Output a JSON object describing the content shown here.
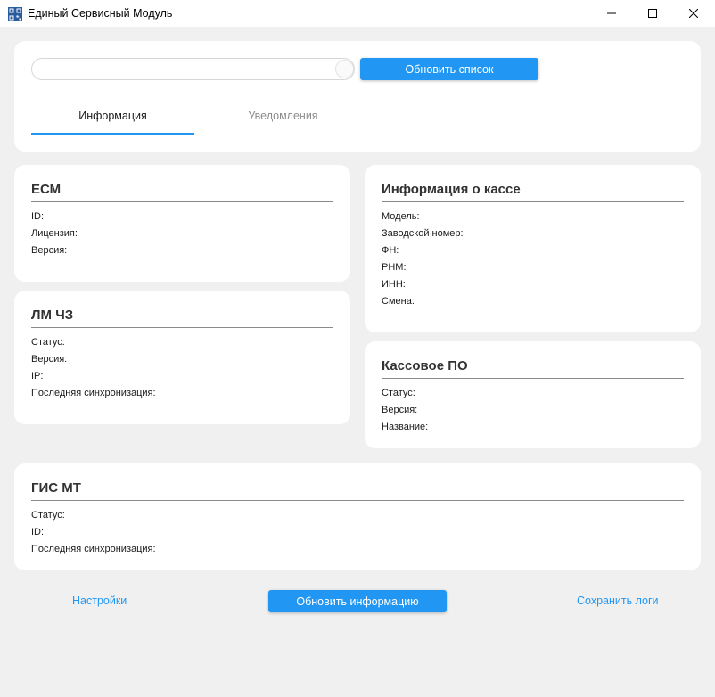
{
  "window": {
    "title": "Единый Сервисный Модуль",
    "icons": {
      "app": "qr-code-icon",
      "minimize": "minimize-icon",
      "maximize": "maximize-icon",
      "close": "close-icon"
    }
  },
  "top": {
    "search": {
      "value": "",
      "placeholder": ""
    },
    "refresh_list_label": "Обновить список",
    "tabs": [
      {
        "label": "Информация",
        "active": true
      },
      {
        "label": "Уведомления",
        "active": false
      }
    ]
  },
  "ecm": {
    "title": "ЕСМ",
    "fields": [
      "ID:",
      "Лицензия:",
      "Версия:"
    ]
  },
  "lm": {
    "title": "ЛМ ЧЗ",
    "fields": [
      "Статус:",
      "Версия:",
      "IP:",
      "Последняя синхронизация:"
    ]
  },
  "kassa": {
    "title": "Информация о кассе",
    "fields": [
      "Модель:",
      "Заводской номер:",
      "ФН:",
      "РНМ:",
      "ИНН:",
      "Смена:"
    ]
  },
  "po": {
    "title": "Кассовое ПО",
    "fields": [
      "Статус:",
      "Версия:",
      "Название:"
    ]
  },
  "gis": {
    "title": "ГИС МТ",
    "fields": [
      "Статус:",
      "ID:",
      "Последняя синхронизация:"
    ]
  },
  "footer": {
    "settings_label": "Настройки",
    "refresh_info_label": "Обновить информацию",
    "save_logs_label": "Сохранить логи"
  },
  "colors": {
    "accent": "#2196f3",
    "background": "#f0f0f0",
    "card": "#ffffff",
    "inactive_tab": "#8c8c8c"
  }
}
